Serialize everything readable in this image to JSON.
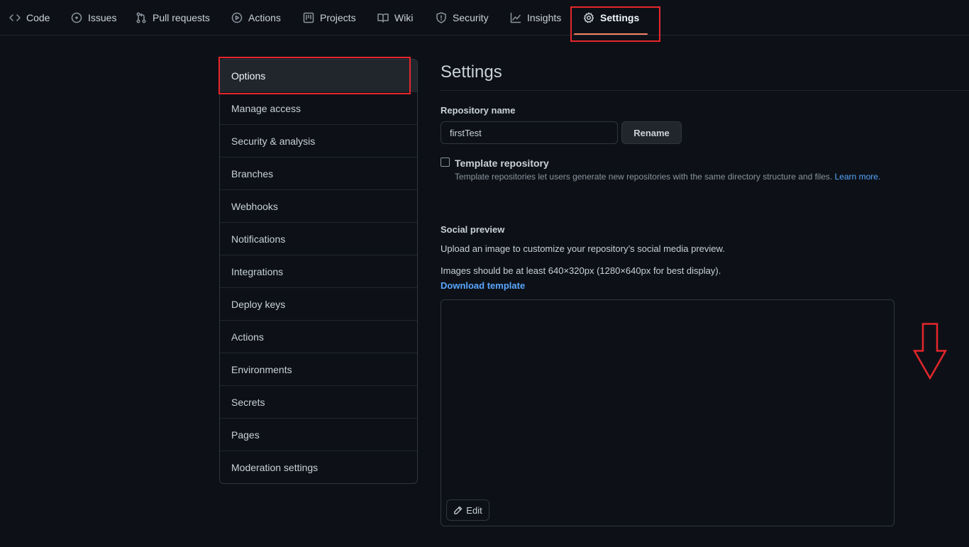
{
  "nav": {
    "tabs": [
      {
        "label": "Code",
        "icon": "code-icon"
      },
      {
        "label": "Issues",
        "icon": "issue-icon"
      },
      {
        "label": "Pull requests",
        "icon": "pull-request-icon"
      },
      {
        "label": "Actions",
        "icon": "play-icon"
      },
      {
        "label": "Projects",
        "icon": "project-icon"
      },
      {
        "label": "Wiki",
        "icon": "book-icon"
      },
      {
        "label": "Security",
        "icon": "shield-icon"
      },
      {
        "label": "Insights",
        "icon": "graph-icon"
      },
      {
        "label": "Settings",
        "icon": "gear-icon",
        "active": true
      }
    ]
  },
  "sidebar": {
    "items": [
      {
        "label": "Options",
        "selected": true
      },
      {
        "label": "Manage access"
      },
      {
        "label": "Security & analysis"
      },
      {
        "label": "Branches"
      },
      {
        "label": "Webhooks"
      },
      {
        "label": "Notifications"
      },
      {
        "label": "Integrations"
      },
      {
        "label": "Deploy keys"
      },
      {
        "label": "Actions"
      },
      {
        "label": "Environments"
      },
      {
        "label": "Secrets"
      },
      {
        "label": "Pages"
      },
      {
        "label": "Moderation settings"
      }
    ]
  },
  "main": {
    "title": "Settings",
    "repo_name_label": "Repository name",
    "repo_name_value": "firstTest",
    "rename_button": "Rename",
    "template_label": "Template repository",
    "template_checked": false,
    "template_desc": "Template repositories let users generate new repositories with the same directory structure and files.",
    "learn_more": "Learn more.",
    "social_title": "Social preview",
    "social_desc": "Upload an image to customize your repository’s social media preview.",
    "social_size": "Images should be at least 640×320px (1280×640px for best display).",
    "download_template": "Download template",
    "edit_button": "Edit"
  },
  "colors": {
    "background": "#0d1117",
    "border": "#30363d",
    "link": "#58a6ff",
    "active_underline": "#f78166",
    "annotation_red": "#e5262b"
  }
}
